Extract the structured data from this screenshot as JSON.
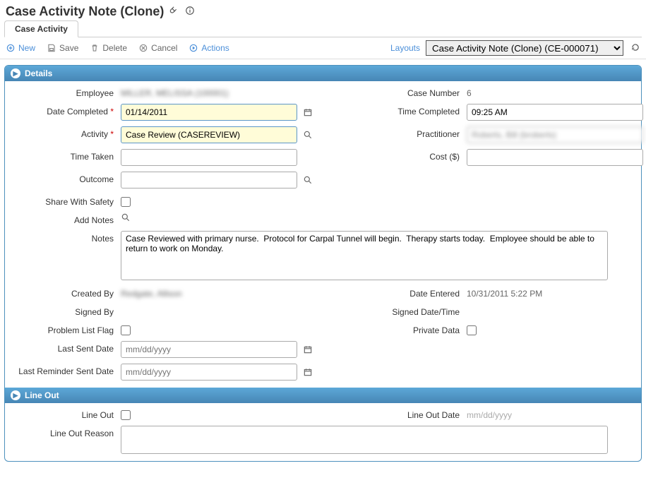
{
  "header": {
    "title": "Case Activity Note (Clone)"
  },
  "tab": {
    "label": "Case Activity"
  },
  "toolbar": {
    "new": "New",
    "save": "Save",
    "delete": "Delete",
    "cancel": "Cancel",
    "actions": "Actions",
    "layouts_label": "Layouts",
    "layout_selected": "Case Activity Note (Clone) (CE-000071)"
  },
  "details": {
    "title": "Details",
    "employee_label": "Employee",
    "employee_value": "MILLER, MELISSA (100001)",
    "case_number_label": "Case Number",
    "case_number_value": "6",
    "date_completed_label": "Date Completed",
    "date_completed_value": "01/14/2011",
    "time_completed_label": "Time Completed",
    "time_completed_value": "09:25 AM",
    "activity_label": "Activity",
    "activity_value": "Case Review (CASEREVIEW)",
    "practitioner_label": "Practitioner",
    "practitioner_value": "Roberts, Bill (broberts)",
    "time_taken_label": "Time Taken",
    "time_taken_value": "",
    "cost_label": "Cost ($)",
    "cost_value": "",
    "outcome_label": "Outcome",
    "outcome_value": "",
    "share_safety_label": "Share With Safety",
    "add_notes_label": "Add Notes",
    "notes_label": "Notes",
    "notes_value": "Case Reviewed with primary nurse.  Protocol for Carpal Tunnel will begin.  Therapy starts today.  Employee should be able to return to work on Monday.",
    "created_by_label": "Created By",
    "created_by_value": "Redgate, Allison",
    "date_entered_label": "Date Entered",
    "date_entered_value": "10/31/2011 5:22 PM",
    "signed_by_label": "Signed By",
    "signed_by_value": "",
    "signed_dt_label": "Signed Date/Time",
    "signed_dt_value": "",
    "problem_flag_label": "Problem List Flag",
    "private_data_label": "Private Data",
    "last_sent_label": "Last Sent Date",
    "last_sent_placeholder": "mm/dd/yyyy",
    "last_reminder_label": "Last Reminder Sent Date",
    "last_reminder_placeholder": "mm/dd/yyyy"
  },
  "lineout": {
    "title": "Line Out",
    "lineout_label": "Line Out",
    "lineout_date_label": "Line Out Date",
    "lineout_date_placeholder": "mm/dd/yyyy",
    "reason_label": "Line Out Reason",
    "reason_value": ""
  }
}
